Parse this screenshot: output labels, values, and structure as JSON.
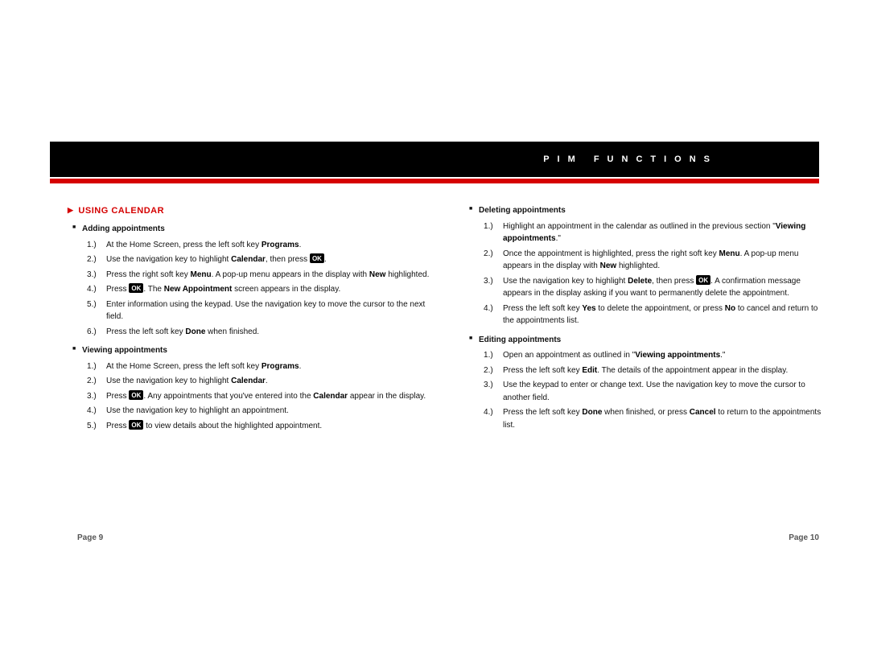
{
  "header": {
    "title": "PIM FUNCTIONS"
  },
  "ok_label": "OK",
  "left": {
    "section_title": "USING CALENDAR",
    "adding": {
      "heading": "Adding appointments",
      "s1_a": "At the Home Screen, press the left soft key ",
      "s1_b": "Programs",
      "s1_c": ".",
      "s2_a": "Use the navigation key to highlight ",
      "s2_b": "Calendar",
      "s2_c": ", then press ",
      "s2_d": ".",
      "s3_a": "Press the right soft key ",
      "s3_b": "Menu",
      "s3_c": ". A pop-up menu appears in the display with ",
      "s3_d": "New",
      "s3_e": " highlighted.",
      "s4_a": "Press ",
      "s4_b": ". The ",
      "s4_c": "New Appointment",
      "s4_d": " screen appears in the display.",
      "s5": "Enter information using the keypad. Use the navigation key to move the cursor to the next field.",
      "s6_a": "Press the left soft key ",
      "s6_b": "Done",
      "s6_c": " when finished."
    },
    "viewing": {
      "heading": "Viewing appointments",
      "s1_a": "At the Home Screen, press the left soft key ",
      "s1_b": "Programs",
      "s1_c": ".",
      "s2_a": "Use the navigation key to highlight ",
      "s2_b": "Calendar",
      "s2_c": ".",
      "s3_a": "Press ",
      "s3_b": ". Any appointments that you've entered into the ",
      "s3_c": "Calendar",
      "s3_d": " appear in the display.",
      "s4": "Use the navigation key to highlight an appointment.",
      "s5_a": "Press ",
      "s5_b": " to view details about the highlighted appointment."
    }
  },
  "right": {
    "deleting": {
      "heading": "Deleting appointments",
      "s1_a": "Highlight an appointment in the calendar as outlined in the previous section \"",
      "s1_b": "Viewing appointments",
      "s1_c": ".\"",
      "s2_a": "Once the appointment is highlighted, press the right soft key ",
      "s2_b": "Menu",
      "s2_c": ". A pop-up menu appears in the display with ",
      "s2_d": "New",
      "s2_e": " highlighted.",
      "s3_a": "Use the navigation key to highlight ",
      "s3_b": "Delete",
      "s3_c": ", then press ",
      "s3_d": ". A confirmation message appears in the display asking if you want to permanently delete the appointment.",
      "s4_a": "Press the left soft key ",
      "s4_b": "Yes",
      "s4_c": " to delete the appointment, or press ",
      "s4_d": "No",
      "s4_e": " to cancel and return to the appointments list."
    },
    "editing": {
      "heading": "Editing appointments",
      "s1_a": "Open an appointment as outlined in \"",
      "s1_b": "Viewing appointments",
      "s1_c": ".\"",
      "s2_a": "Press the left soft key ",
      "s2_b": "Edit",
      "s2_c": ". The details of the appointment appear in the display.",
      "s3": "Use the keypad to enter or change text. Use the navigation key to move the cursor to another field.",
      "s4_a": "Press the left soft key ",
      "s4_b": "Done",
      "s4_c": " when finished, or press ",
      "s4_d": "Cancel",
      "s4_e": " to return to the appointments list."
    }
  },
  "footer": {
    "left": "Page 9",
    "right": "Page 10"
  }
}
